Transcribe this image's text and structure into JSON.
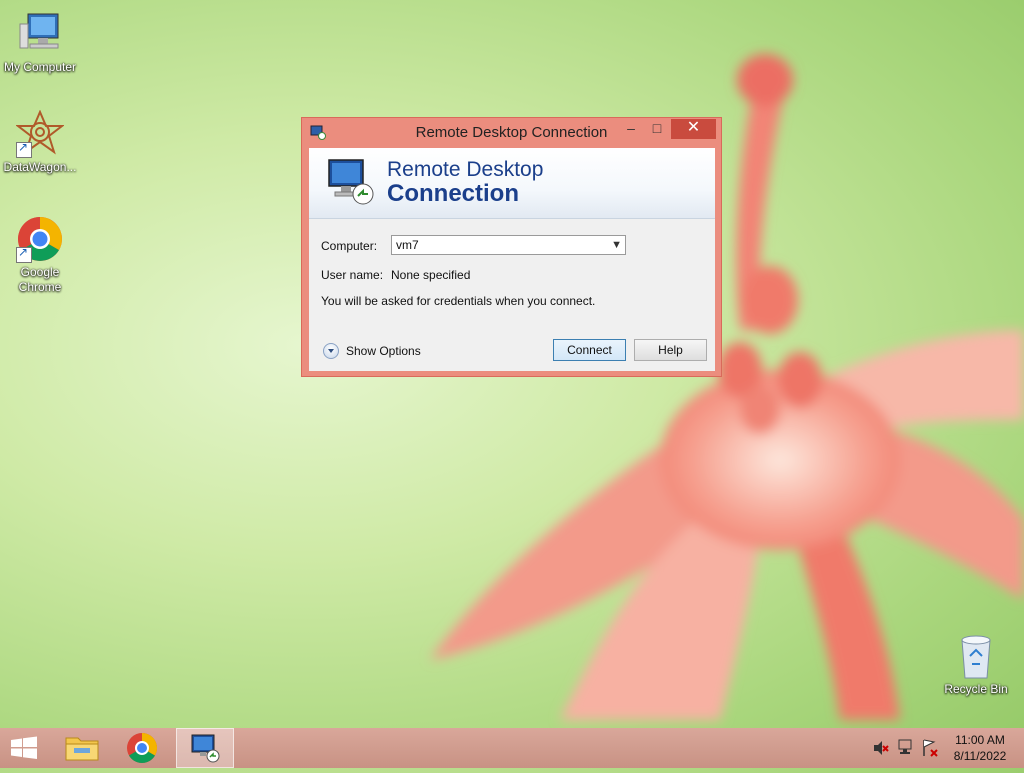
{
  "desktop": {
    "icons": [
      {
        "label": "My Computer",
        "icon": "computer-icon"
      },
      {
        "label": "DataWagon...",
        "icon": "datawagon-icon"
      },
      {
        "label": "Google Chrome",
        "icon": "chrome-icon"
      },
      {
        "label": "Recycle Bin",
        "icon": "recycle-bin-icon"
      }
    ]
  },
  "window": {
    "title": "Remote Desktop Connection",
    "banner_line1": "Remote Desktop",
    "banner_line2": "Connection",
    "computer_label": "Computer:",
    "computer_value": "vm7",
    "username_label": "User name:",
    "username_value": "None specified",
    "info_text": "You will be asked for credentials when you connect.",
    "show_options": "Show Options",
    "connect_button": "Connect",
    "help_button": "Help",
    "minimize_glyph": "–",
    "maximize_glyph": "□",
    "close_glyph": "✕"
  },
  "taskbar": {
    "time": "11:00 AM",
    "date": "8/11/2022",
    "items": [
      "start-button",
      "file-explorer",
      "google-chrome",
      "remote-desktop-connection"
    ]
  },
  "colors": {
    "accent_title": "#1b3f8b",
    "window_frame": "#eb8d7e",
    "close_button": "#c94b3e",
    "taskbar": "#d0998b"
  }
}
